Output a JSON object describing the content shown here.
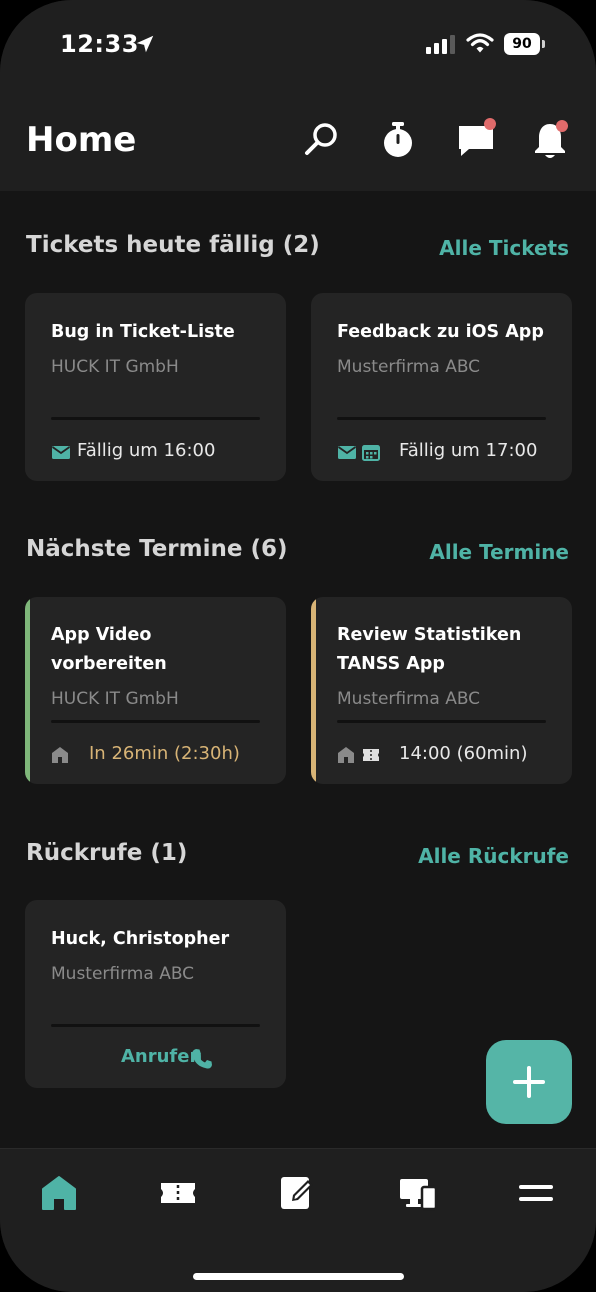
{
  "status_bar": {
    "time": "12:33",
    "battery": "90"
  },
  "header": {
    "title": "Home"
  },
  "tickets": {
    "title": "Tickets heute fällig (2)",
    "link": "Alle Tickets",
    "items": [
      {
        "title": "Bug in Ticket-Liste",
        "company": "HUCK IT GmbH",
        "due": "Fällig um 16:00"
      },
      {
        "title": "Feedback zu iOS App",
        "company": "Musterfirma ABC",
        "due": "Fällig um 17:00"
      }
    ]
  },
  "appointments": {
    "title": "Nächste Termine (6)",
    "link": "Alle Termine",
    "items": [
      {
        "title_line1": "App Video",
        "title_line2": "vorbereiten",
        "company": "HUCK IT GmbH",
        "time": "In 26min (2:30h)",
        "accent_color": "#7fb77a"
      },
      {
        "title_line1": "Review Statistiken",
        "title_line2": "TANSS App",
        "company": "Musterfirma ABC",
        "time": "14:00 (60min)",
        "accent_color": "#d8b476"
      }
    ]
  },
  "callbacks": {
    "title": "Rückrufe (1)",
    "link": "Alle Rückrufe",
    "items": [
      {
        "name": "Huck, Christopher",
        "company": "Musterfirma ABC",
        "action": "Anrufen"
      }
    ]
  },
  "icons": {
    "header": [
      "search-icon",
      "stopwatch-icon",
      "chat-icon",
      "bell-icon"
    ],
    "tabs": [
      "home-icon",
      "ticket-icon",
      "edit-icon",
      "devices-icon",
      "menu-icon"
    ],
    "fab": "plus-icon"
  },
  "colors": {
    "accent": "#4fb3a6",
    "notification": "#e06b6b",
    "warning": "#d8b476",
    "success": "#7fb77a"
  }
}
